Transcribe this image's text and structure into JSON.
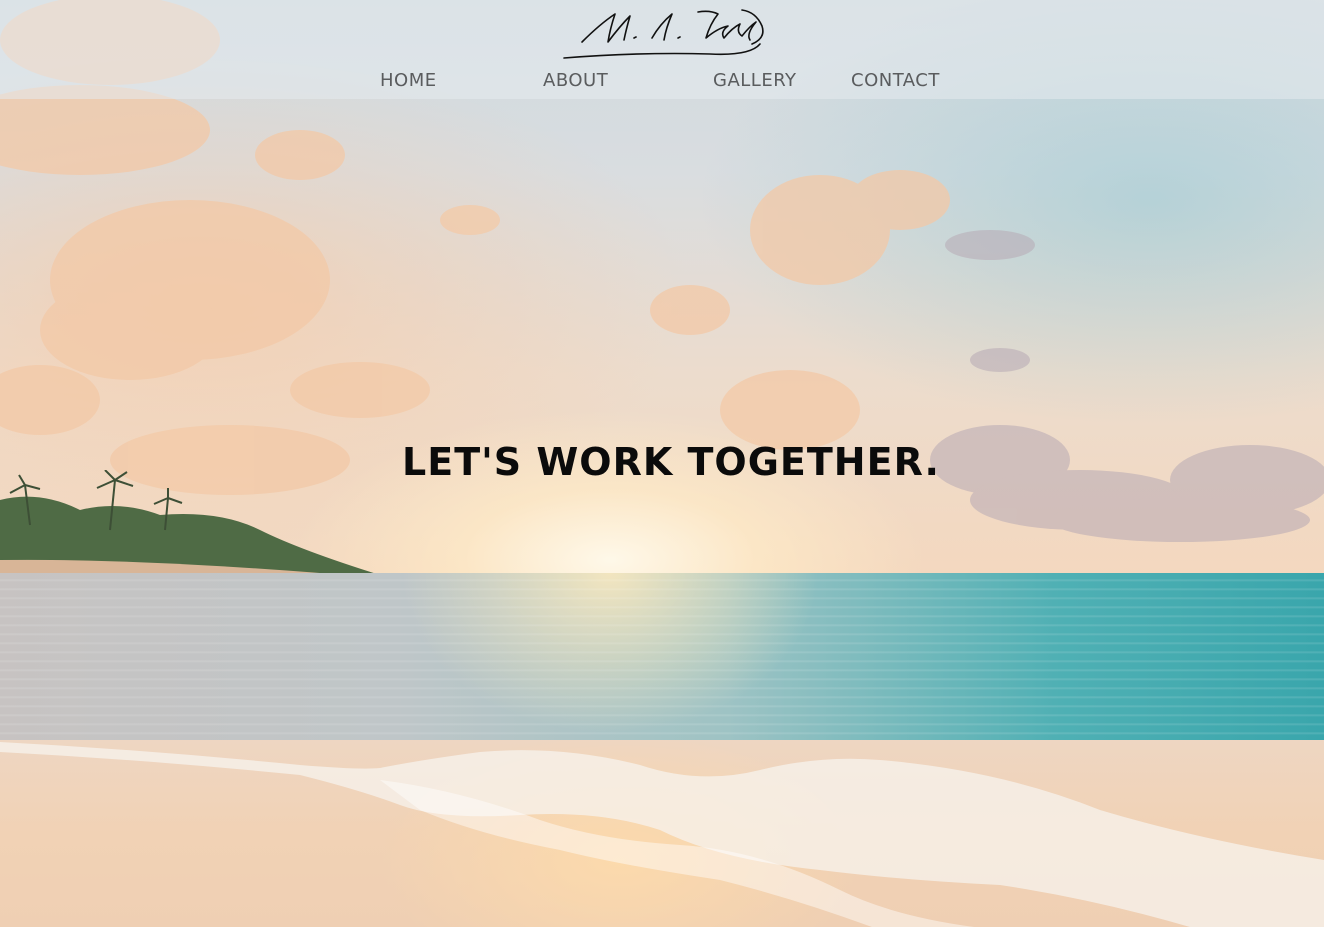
{
  "header": {
    "logo": {
      "kind": "signature",
      "text": "M. A. Brassard"
    },
    "nav": [
      {
        "label": "HOME"
      },
      {
        "label": "ABOUT"
      },
      {
        "label": "GALLERY"
      },
      {
        "label": "CONTACT"
      }
    ]
  },
  "hero": {
    "title": "LET'S WORK TOGETHER.",
    "background": "beach-sunset-photo"
  },
  "colors": {
    "nav_text": "#5a5c5e",
    "title_text": "#0b0b0b",
    "sea_teal": "#3aa6ac",
    "sand": "#f1d2b5"
  }
}
